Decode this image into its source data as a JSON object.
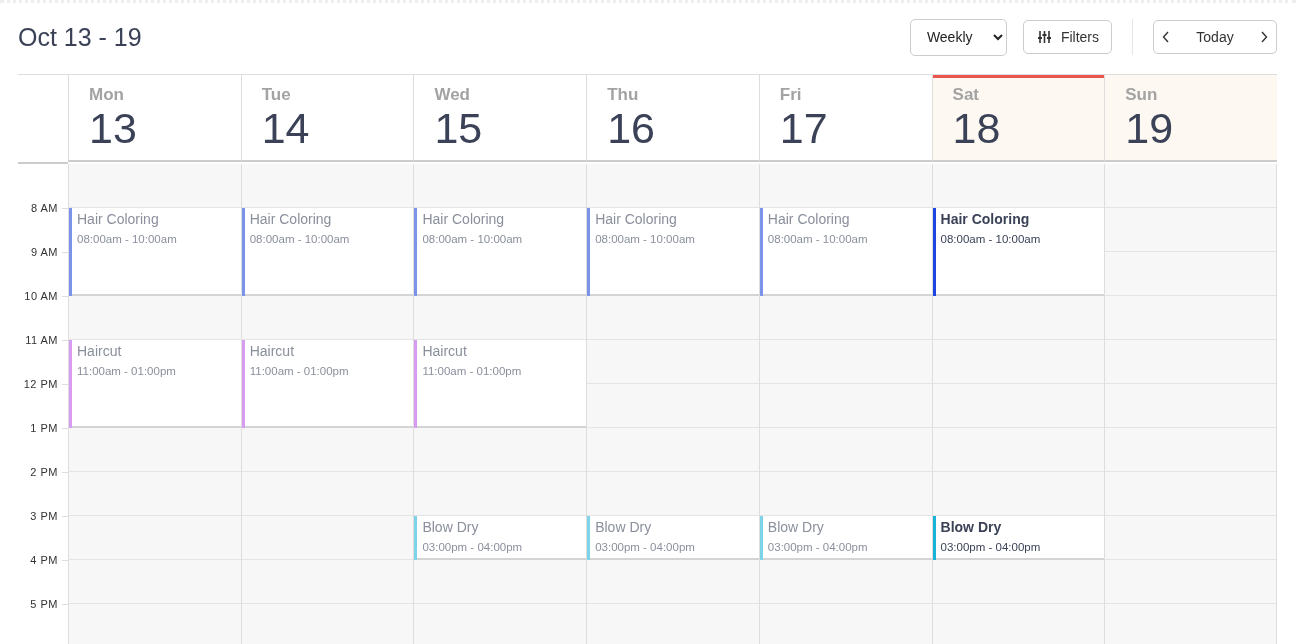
{
  "title": "Oct 13 - 19",
  "toolbar": {
    "view": "Weekly",
    "filters": "Filters",
    "today": "Today"
  },
  "hours": [
    "8 AM",
    "9 AM",
    "10 AM",
    "11 AM",
    "12 PM",
    "1 PM",
    "2 PM",
    "3 PM",
    "4 PM",
    "5 PM"
  ],
  "days": [
    {
      "name": "Mon",
      "date": "13",
      "today": false,
      "weekend": false,
      "events": [
        {
          "title": "Hair Coloring",
          "time": "08:00am - 10:00am",
          "color": "#7b93e8",
          "past": true
        },
        {
          "title": "Haircut",
          "time": "11:00am - 01:00pm",
          "color": "#d79cf0",
          "past": true
        }
      ]
    },
    {
      "name": "Tue",
      "date": "14",
      "today": false,
      "weekend": false,
      "events": [
        {
          "title": "Hair Coloring",
          "time": "08:00am - 10:00am",
          "color": "#7b93e8",
          "past": true
        },
        {
          "title": "Haircut",
          "time": "11:00am - 01:00pm",
          "color": "#d79cf0",
          "past": true
        }
      ]
    },
    {
      "name": "Wed",
      "date": "15",
      "today": false,
      "weekend": false,
      "events": [
        {
          "title": "Hair Coloring",
          "time": "08:00am - 10:00am",
          "color": "#7b93e8",
          "past": true
        },
        {
          "title": "Haircut",
          "time": "11:00am - 01:00pm",
          "color": "#d79cf0",
          "past": true
        },
        {
          "title": "Blow Dry",
          "time": "03:00pm - 04:00pm",
          "color": "#7dd3e8",
          "past": true
        }
      ]
    },
    {
      "name": "Thu",
      "date": "16",
      "today": false,
      "weekend": false,
      "events": [
        {
          "title": "Hair Coloring",
          "time": "08:00am - 10:00am",
          "color": "#7b93e8",
          "past": true
        },
        {
          "title": "Blow Dry",
          "time": "03:00pm - 04:00pm",
          "color": "#7dd3e8",
          "past": true
        }
      ]
    },
    {
      "name": "Fri",
      "date": "17",
      "today": false,
      "weekend": false,
      "events": [
        {
          "title": "Hair Coloring",
          "time": "08:00am - 10:00am",
          "color": "#7b93e8",
          "past": true
        },
        {
          "title": "Blow Dry",
          "time": "03:00pm - 04:00pm",
          "color": "#7dd3e8",
          "past": true
        }
      ]
    },
    {
      "name": "Sat",
      "date": "18",
      "today": true,
      "weekend": true,
      "events": [
        {
          "title": "Hair Coloring",
          "time": "08:00am - 10:00am",
          "color": "#1f45e0",
          "past": false
        },
        {
          "title": "Blow Dry",
          "time": "03:00pm - 04:00pm",
          "color": "#18b4d8",
          "past": false
        }
      ]
    },
    {
      "name": "Sun",
      "date": "19",
      "today": false,
      "weekend": true
    }
  ]
}
